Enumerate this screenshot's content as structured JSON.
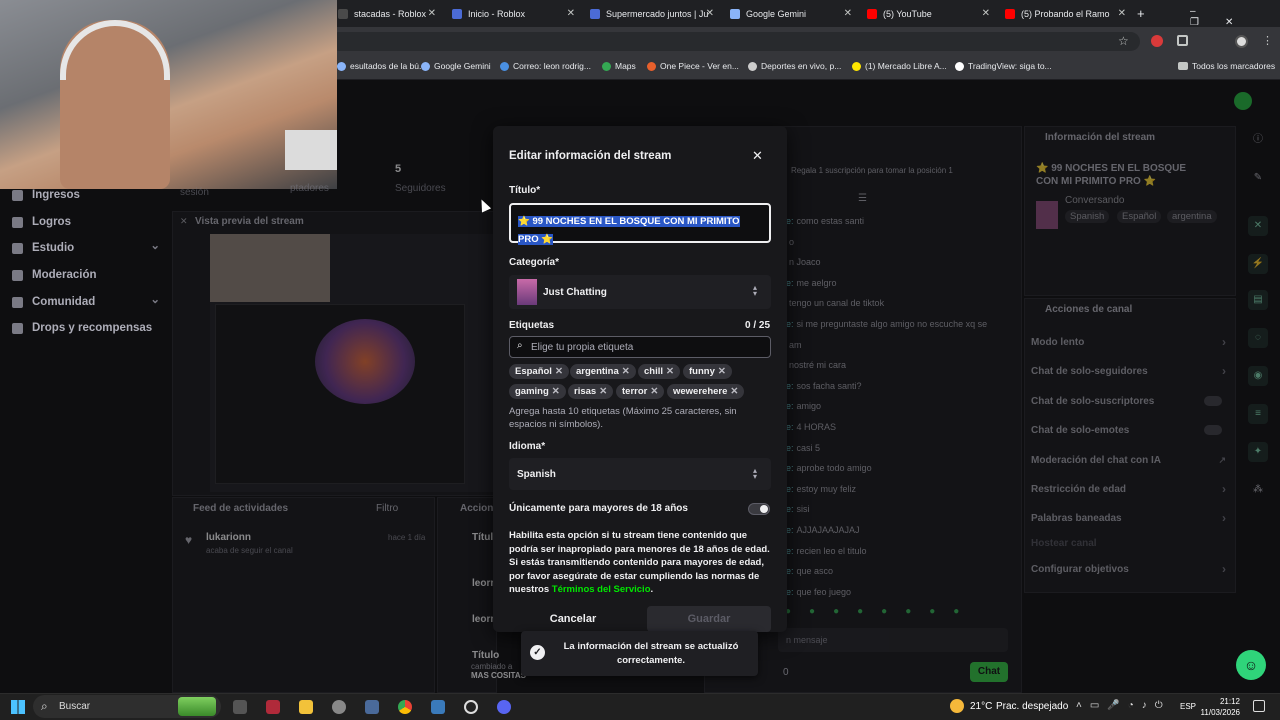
{
  "browser": {
    "tabs": [
      {
        "label": "stacadas - Roblox",
        "fav": "#4a4a4a"
      },
      {
        "label": "Inicio - Roblox",
        "fav": "#4b6bd6"
      },
      {
        "label": "Supermercado juntos | Ju",
        "fav": "#4b6bd6"
      },
      {
        "label": "Google Gemini",
        "fav": "#8ab4f8"
      },
      {
        "label": "(5) YouTube",
        "fav": "#ff0000"
      },
      {
        "label": "(5) Probando el Ramo",
        "fav": "#ff0000"
      }
    ],
    "bookmarks": [
      {
        "label": "esultados de la bú...",
        "color": "#8ab4f8"
      },
      {
        "label": "Google Gemini",
        "color": "#8ab4f8"
      },
      {
        "label": "Correo: leon rodrig...",
        "color": "#4a90e2"
      },
      {
        "label": "Maps",
        "color": "#34a853"
      },
      {
        "label": "One Piece - Ver en...",
        "color": "#e8602c"
      },
      {
        "label": "Deportes en vivo, p...",
        "color": "#cccccc"
      },
      {
        "label": "(1) Mercado Libre A...",
        "color": "#ffe600"
      },
      {
        "label": "TradingView: siga to...",
        "color": "#ffffff"
      }
    ],
    "all_bookmarks": "Todos los marcadores"
  },
  "sidebar": [
    {
      "label": "Ingresos",
      "chev": ""
    },
    {
      "label": "Logros",
      "chev": ""
    },
    {
      "label": "Estudio",
      "chev": "⌄"
    },
    {
      "label": "Moderación",
      "chev": ""
    },
    {
      "label": "Comunidad",
      "chev": "⌄"
    },
    {
      "label": "Drops y recompensas",
      "chev": ""
    }
  ],
  "stats": {
    "sesion": "sesión",
    "count": "5",
    "followers_partial": "ptadores",
    "seguidores": "Seguidores"
  },
  "preview_title": "Vista previa del stream",
  "feed": {
    "title": "Feed de actividades",
    "filter": "Filtro",
    "user": "lukarionn",
    "time": "hace 1 día",
    "desc": "acaba de seguir el canal"
  },
  "actions_partial": {
    "title": "Accione",
    "items": [
      "Título",
      "leorr",
      "leorr",
      "Título"
    ],
    "bottom_text": "cambiado a",
    "bottom_text2": "MAS COSITAS"
  },
  "chat": {
    "banner": "Regala 1 suscripción para tomar la posición 1",
    "lines": [
      {
        "u": "e:",
        "t": "como estas santi"
      },
      {
        "u": "",
        "t": "o"
      },
      {
        "u": "",
        "t": "n Joaco"
      },
      {
        "u": "e:",
        "t": "me aelgro"
      },
      {
        "u": "",
        "t": "tengo un canal de tiktok"
      },
      {
        "u": "e:",
        "t": "si me preguntaste algo amigo no escuche xq se"
      },
      {
        "u": "",
        "t": "am"
      },
      {
        "u": "",
        "t": "nostré mi cara"
      },
      {
        "u": "e:",
        "t": "sos facha santi?"
      },
      {
        "u": "e:",
        "t": "amigo"
      },
      {
        "u": "e:",
        "t": "4 HORAS"
      },
      {
        "u": "e:",
        "t": "casi 5"
      },
      {
        "u": "e:",
        "t": "aprobe todo amigo"
      },
      {
        "u": "e:",
        "t": "estoy muy feliz"
      },
      {
        "u": "e:",
        "t": "sisi"
      },
      {
        "u": "e:",
        "t": "AJJAJAAJAJAJ"
      },
      {
        "u": "e:",
        "t": "recien leo el titulo"
      },
      {
        "u": "e:",
        "t": "que asco"
      },
      {
        "u": "e:",
        "t": "que feo juego"
      }
    ],
    "input_placeholder": "n mensaje",
    "points": "0",
    "send": "Chat"
  },
  "stream_info": {
    "header": "Información del stream",
    "title": "⭐ 99 NOCHES EN EL BOSQUE CON MI PRIMITO PRO ⭐",
    "category": "Conversando",
    "tags": [
      "Spanish",
      "Español",
      "argentina"
    ]
  },
  "channel_actions": {
    "header": "Acciones de canal",
    "items": [
      {
        "label": "Modo lento",
        "ctl": "chev"
      },
      {
        "label": "Chat de solo-seguidores",
        "ctl": "chev"
      },
      {
        "label": "Chat de solo-suscriptores",
        "ctl": "toggle"
      },
      {
        "label": "Chat de solo-emotes",
        "ctl": "toggle"
      },
      {
        "label": "Moderación del chat con IA",
        "ctl": "ext"
      },
      {
        "label": "Restricción de edad",
        "ctl": "chev"
      },
      {
        "label": "Palabras baneadas",
        "ctl": "chev"
      },
      {
        "label": "Hostear canal",
        "ctl": "none"
      },
      {
        "label": "Configurar objetivos",
        "ctl": "chev"
      }
    ]
  },
  "modal": {
    "title": "Editar información del stream",
    "title_label": "Título*",
    "title_value": "⭐ 99 NOCHES EN EL BOSQUE CON MI PRIMITO PRO ⭐",
    "category_label": "Categoría*",
    "category_value": "Just Chatting",
    "tags_label": "Etiquetas",
    "tags_count": "0 / 25",
    "tags_placeholder": "Elige tu propia etiqueta",
    "tags": [
      "Español",
      "argentina",
      "chill",
      "funny",
      "gaming",
      "risas",
      "terror",
      "wewerehere"
    ],
    "tags_help": "Agrega hasta 10 etiquetas (Máximo 25 caracteres, sin espacios ni símbolos).",
    "language_label": "Idioma*",
    "language_value": "Spanish",
    "mature_label": "Únicamente para mayores de 18 años",
    "mature_help": "Habilita esta opción si tu stream tiene contenido que podría ser inapropiado para menores de 18 años de edad. Si estás transmitiendo contenido para mayores de edad, por favor asegúrate de estar cumpliendo las normas de nuestros",
    "terms": "Términos del Servicio",
    "terms_suffix": ".",
    "cancel": "Cancelar",
    "save": "Guardar"
  },
  "toast": "La información del stream se actualizó correctamente.",
  "taskbar": {
    "search": "Buscar",
    "weather": "21°C",
    "weather_desc": "Prac. despejado",
    "lang": "ESP",
    "time": "21:12",
    "date": "11/03/2026"
  },
  "colors": {
    "accent": "#00e701",
    "toast_bg": "#1f1f23",
    "brand": "#53fc18"
  }
}
